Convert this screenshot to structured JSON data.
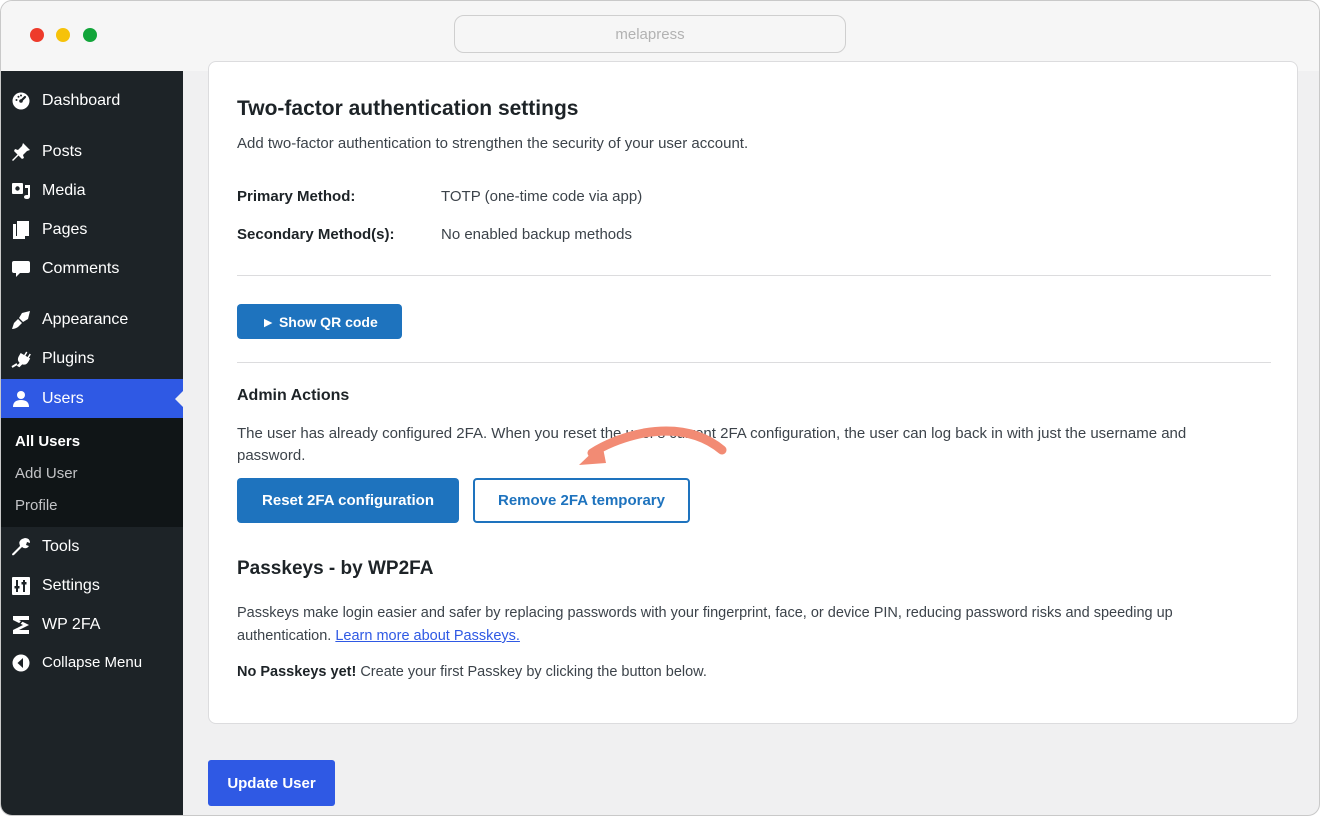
{
  "browser": {
    "url": "melapress"
  },
  "sidebar": {
    "items": [
      {
        "label": "Dashboard",
        "icon": "dashboard-icon"
      },
      {
        "label": "Posts",
        "icon": "pin-icon"
      },
      {
        "label": "Media",
        "icon": "media-icon"
      },
      {
        "label": "Pages",
        "icon": "pages-icon"
      },
      {
        "label": "Comments",
        "icon": "comment-icon"
      },
      {
        "label": "Appearance",
        "icon": "brush-icon"
      },
      {
        "label": "Plugins",
        "icon": "plug-icon"
      },
      {
        "label": "Users",
        "icon": "user-icon"
      },
      {
        "label": "Tools",
        "icon": "wrench-icon"
      },
      {
        "label": "Settings",
        "icon": "settings-icon"
      },
      {
        "label": "WP 2FA",
        "icon": "wp2fa-icon"
      },
      {
        "label": "Collapse Menu",
        "icon": "collapse-icon"
      }
    ],
    "submenu": [
      "All Users",
      "Add User",
      "Profile"
    ],
    "active_color": "#2f59e4"
  },
  "tfa": {
    "title": "Two-factor authentication settings",
    "description": "Add two-factor authentication to strengthen the security of your user account.",
    "primary_label": "Primary Method:",
    "primary_value": "TOTP (one-time code via app)",
    "secondary_label": "Secondary Method(s):",
    "secondary_value": "No enabled backup methods",
    "qr_button": "► Show QR code"
  },
  "admin_actions": {
    "title": "Admin Actions",
    "text_line1": "The user has already configured 2FA. When you reset the user's current 2FA configuration, the user can log back in with just the username and",
    "text_line2": "password.",
    "reset_button": "Reset 2FA configuration",
    "remove_button": "Remove 2FA temporary"
  },
  "passkeys": {
    "title": "Passkeys - by WP2FA",
    "desc_line1": "Passkeys make login easier and safer by replacing passwords with your fingerprint, face, or device PIN, reducing password risks and speeding up",
    "desc_line2": "authentication.",
    "learn_more": "Learn more about Passkeys.",
    "none_bold": "No Passkeys yet!",
    "none_text": "Create your first Passkey by clicking the button below."
  },
  "footer": {
    "update_button": "Update User"
  },
  "colors": {
    "primary": "#1e73be",
    "accent_arrow": "#f28b74"
  }
}
